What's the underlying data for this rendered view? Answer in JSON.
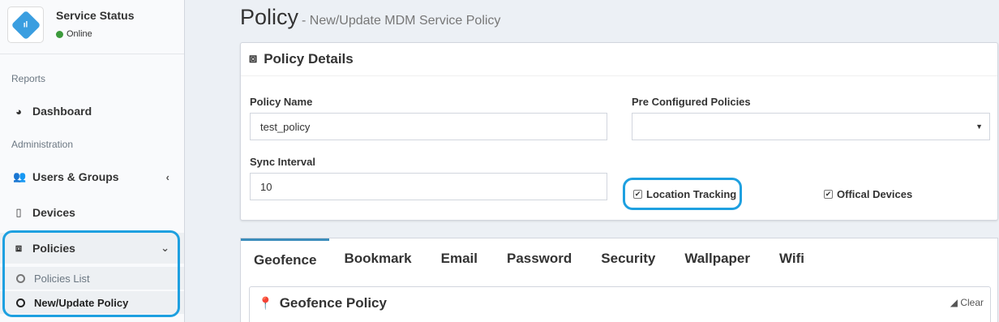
{
  "sidebar": {
    "service_title": "Service Status",
    "status_text": "Online",
    "status_color": "#3c9a3c",
    "headers": [
      "Reports",
      "Administration"
    ],
    "items": [
      {
        "label": "Dashboard",
        "icon": "dashboard-icon"
      },
      {
        "label": "Users & Groups",
        "icon": "users-icon"
      },
      {
        "label": "Devices",
        "icon": "mobile-icon"
      },
      {
        "label": "Policies",
        "icon": "policy-icon"
      }
    ],
    "sub_items": [
      {
        "label": "Policies List"
      },
      {
        "label": "New/Update Policy"
      }
    ]
  },
  "page": {
    "title": "Policy",
    "subtitle": "- New/Update MDM Service Policy"
  },
  "details": {
    "header": "Policy Details",
    "policy_name_label": "Policy Name",
    "policy_name_value": "test_policy",
    "preconf_label": "Pre Configured Policies",
    "preconf_value": "",
    "sync_label": "Sync Interval",
    "sync_value": "10",
    "location_tracking_label": "Location Tracking",
    "location_tracking_checked": true,
    "offical_devices_label": "Offical Devices",
    "offical_devices_checked": true
  },
  "tabs": [
    {
      "label": "Geofence",
      "active": true
    },
    {
      "label": "Bookmark"
    },
    {
      "label": "Email"
    },
    {
      "label": "Password"
    },
    {
      "label": "Security"
    },
    {
      "label": "Wallpaper"
    },
    {
      "label": "Wifi"
    }
  ],
  "geofence": {
    "title": "Geofence Policy",
    "clear_label": "Clear"
  },
  "colors": {
    "accent": "#3c8dbc",
    "highlight": "#1ea0e0"
  }
}
